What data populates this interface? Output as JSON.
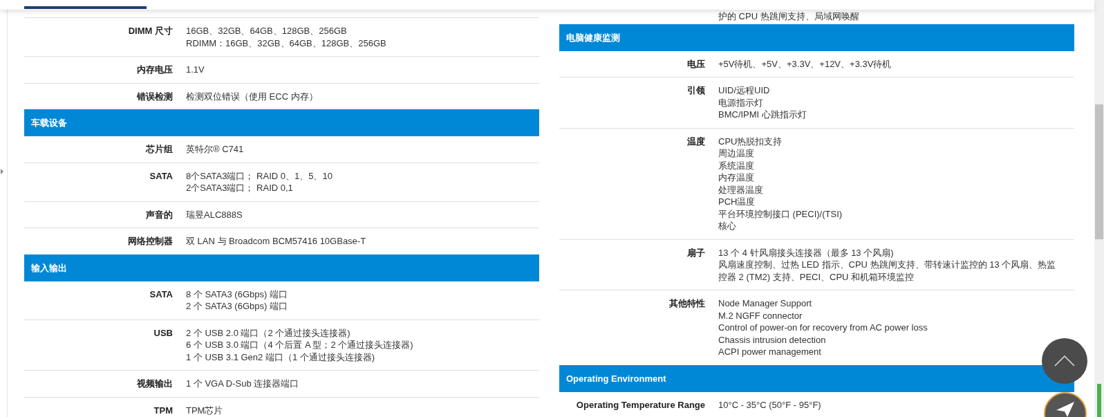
{
  "left_column": [
    {
      "kind": "row",
      "label": "DIMM 尺寸",
      "lines": [
        "16GB、32GB、64GB、128GB、256GB",
        "RDIMM：16GB、32GB、64GB、128GB、256GB"
      ]
    },
    {
      "kind": "row",
      "label": "内存电压",
      "lines": [
        "1.1V"
      ]
    },
    {
      "kind": "row",
      "label": "错误检测",
      "lines": [
        "检测双位错误（使用 ECC 内存）"
      ]
    },
    {
      "kind": "heading",
      "label": "车载设备"
    },
    {
      "kind": "row",
      "label": "芯片组",
      "lines": [
        "英特尔® C741"
      ]
    },
    {
      "kind": "row",
      "label": "SATA",
      "lines": [
        "8个SATA3端口； RAID 0、1、5、10",
        "2个SATA3端口； RAID 0,1"
      ]
    },
    {
      "kind": "row",
      "label": "声音的",
      "lines": [
        "瑞昱ALC888S"
      ]
    },
    {
      "kind": "row",
      "label": "网络控制器",
      "lines": [
        "双 LAN 与 Broadcom BCM57416 10GBase-T"
      ]
    },
    {
      "kind": "heading",
      "label": "输入输出"
    },
    {
      "kind": "row",
      "label": "SATA",
      "lines": [
        "8 个 SATA3 (6Gbps) 端口",
        "2 个 SATA3 (6Gbps) 端口"
      ]
    },
    {
      "kind": "row",
      "label": "USB",
      "lines": [
        "2 个 USB 2.0 端口（2 个通过接头连接器)",
        "6 个 USB 3.0 端口（4 个后置 A 型；2 个通过接头连接器)",
        "1 个 USB 3.1 Gen2 端口（1 个通过接头连接器)"
      ]
    },
    {
      "kind": "row",
      "label": "视频输出",
      "lines": [
        "1 个 VGA D-Sub 连接器端口"
      ]
    },
    {
      "kind": "row",
      "label": "TPM",
      "lines": [
        "TPM芯片"
      ]
    }
  ],
  "right_column": [
    {
      "kind": "partial",
      "lines": [
        "护的 CPU 热跳闸支持、局域网唤醒"
      ]
    },
    {
      "kind": "heading",
      "label": "电脑健康监测"
    },
    {
      "kind": "row",
      "label": "电压",
      "lines": [
        "+5V待机、+5V、+3.3V、+12V、+3.3V待机"
      ]
    },
    {
      "kind": "row",
      "label": "引领",
      "lines": [
        "UID/远程UID",
        "电源指示灯",
        "BMC/IPMI 心跳指示灯"
      ]
    },
    {
      "kind": "row",
      "label": "温度",
      "lines": [
        "CPU热脱扣支持",
        "周边温度",
        "系统温度",
        "内存温度",
        "处理器温度",
        "PCH温度",
        "平台环境控制接口 (PECI)/(TSI)",
        "核心"
      ]
    },
    {
      "kind": "row",
      "label": "扇子",
      "lines": [
        "13 个 4 针风扇接头连接器（最多 13 个风扇)",
        "风扇速度控制、过热 LED 指示、CPU 热跳闸支持、带转速计监控的 13 个风扇、热监控器 2 (TM2) 支持、PECI、CPU 和机箱环境监控"
      ]
    },
    {
      "kind": "row",
      "label": "其他特性",
      "lines": [
        "Node Manager Support",
        "M.2 NGFF connector",
        "Control of power-on for recovery from AC power loss",
        "Chassis intrusion detection",
        "ACPI power management"
      ]
    },
    {
      "kind": "heading",
      "label": "Operating Environment"
    },
    {
      "kind": "row",
      "label": "Operating Temperature Range",
      "lines": [
        "10°C - 35°C (50°F - 95°F)"
      ]
    }
  ]
}
